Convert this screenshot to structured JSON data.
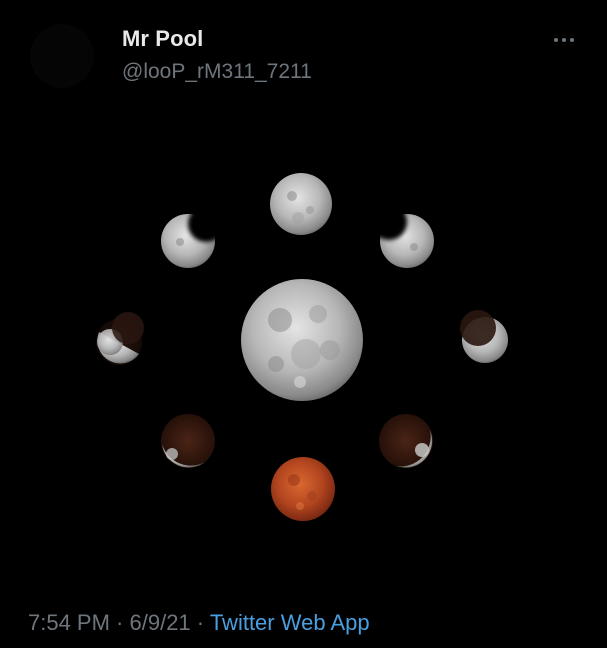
{
  "tweet": {
    "display_name": "Mr Pool",
    "handle": "@looP_rM311_7211",
    "time": "7:54 PM",
    "separator": " · ",
    "date": "6/9/21",
    "source": "Twitter Web App",
    "more_icon": "more-horizontal-icon"
  },
  "media": {
    "subject": "lunar eclipse phases arranged in a circle",
    "colors": {
      "full_moon": "#bdbdbd",
      "shadow": "#3a1c12",
      "blood_moon": "#b2451f"
    }
  }
}
